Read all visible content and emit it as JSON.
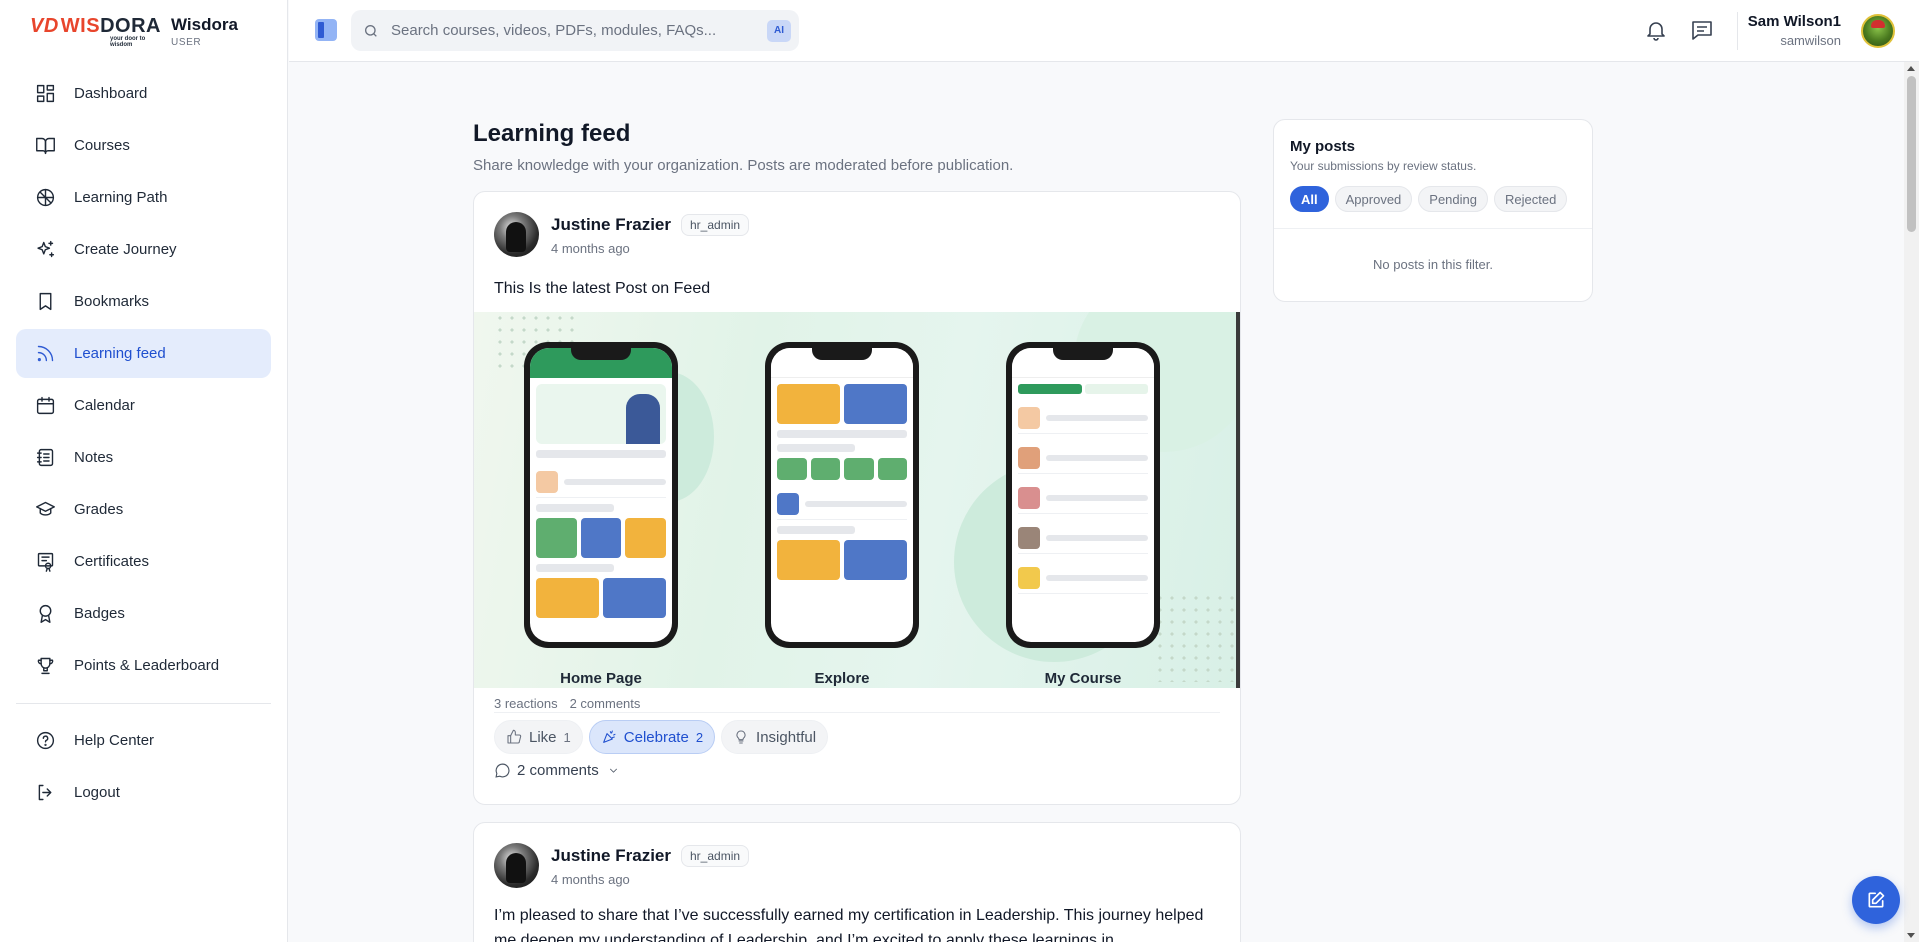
{
  "brand": {
    "logo_vd": "VD",
    "logo_wis": "WIS",
    "logo_dora": "DORA",
    "logo_tagline": "your door to wisdom",
    "name": "Wisdora",
    "role": "USER"
  },
  "sidebar": {
    "items": [
      {
        "label": "Dashboard",
        "icon": "dashboard-icon"
      },
      {
        "label": "Courses",
        "icon": "book-icon"
      },
      {
        "label": "Learning Path",
        "icon": "path-icon"
      },
      {
        "label": "Create Journey",
        "icon": "sparkles-icon"
      },
      {
        "label": "Bookmarks",
        "icon": "bookmark-icon"
      },
      {
        "label": "Learning feed",
        "icon": "rss-icon",
        "active": true
      },
      {
        "label": "Calendar",
        "icon": "calendar-icon"
      },
      {
        "label": "Notes",
        "icon": "notes-icon"
      },
      {
        "label": "Grades",
        "icon": "graduation-cap-icon"
      },
      {
        "label": "Certificates",
        "icon": "certificate-icon"
      },
      {
        "label": "Badges",
        "icon": "badge-icon"
      },
      {
        "label": "Points & Leaderboard",
        "icon": "trophy-icon"
      }
    ],
    "bottom": [
      {
        "label": "Help Center",
        "icon": "help-icon"
      },
      {
        "label": "Logout",
        "icon": "logout-icon"
      }
    ]
  },
  "header": {
    "search_placeholder": "Search courses, videos, PDFs, modules, FAQs...",
    "ai_badge": "AI",
    "user_name": "Sam Wilson1",
    "user_handle": "samwilson"
  },
  "feed": {
    "title": "Learning feed",
    "subtitle": "Share knowledge with your organization. Posts are moderated before publication."
  },
  "posts": [
    {
      "author": "Justine Frazier",
      "role": "hr_admin",
      "time": "4 months ago",
      "text": "This Is the latest Post on Feed",
      "image_labels": [
        "Home Page",
        "Explore",
        "My Course"
      ],
      "reactions": "3 reactions",
      "comments": "2 comments",
      "actions": [
        {
          "label": "Like",
          "count": "1",
          "active": false
        },
        {
          "label": "Celebrate",
          "count": "2",
          "active": true
        },
        {
          "label": "Insightful",
          "count": "",
          "active": false
        }
      ],
      "comments_toggle": "2 comments"
    },
    {
      "author": "Justine Frazier",
      "role": "hr_admin",
      "time": "4 months ago",
      "text": "I’m pleased to share that I’ve successfully earned my certification in Leadership. This journey helped me deepen my understanding of Leadership, and I’m excited to apply these learnings in"
    }
  ],
  "my_posts": {
    "title": "My posts",
    "subtitle": "Your submissions by review status.",
    "filters": [
      "All",
      "Approved",
      "Pending",
      "Rejected"
    ],
    "active_filter": "All",
    "empty": "No posts in this filter."
  },
  "colors": {
    "accent": "#2f63dc",
    "active_nav_bg": "#e4ecfc",
    "brand_red": "#e8452c"
  }
}
